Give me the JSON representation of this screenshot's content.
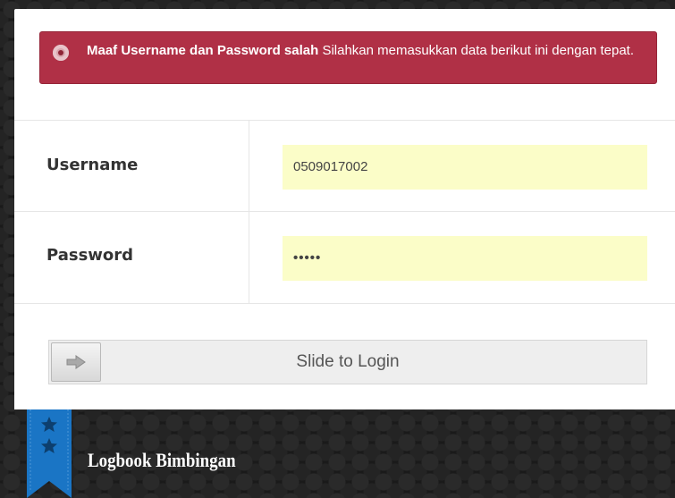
{
  "alert": {
    "bold_text": "Maaf Username dan Password salah",
    "text": " Silahkan memasukkan data berikut ini dengan tepat."
  },
  "form": {
    "username_label": "Username",
    "username_value": "0509017002",
    "password_label": "Password",
    "password_value": "•••••"
  },
  "slider": {
    "label": "Slide to Login",
    "handle_icon": "arrow-right-icon"
  },
  "brand": {
    "title": "Logbook Bimbingan",
    "ribbon_icon": "star-icon"
  },
  "colors": {
    "alert_bg": "#b03046",
    "input_bg": "#fbfdc8",
    "ribbon": "#1a75c5"
  }
}
